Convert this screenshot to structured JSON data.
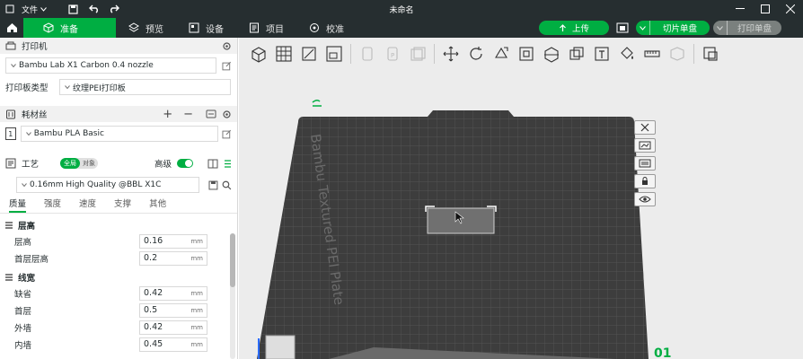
{
  "titlebar": {
    "file_menu": "文件",
    "window_title": "未命名"
  },
  "nav": {
    "tabs": [
      {
        "label": "准备"
      },
      {
        "label": "预览"
      },
      {
        "label": "设备"
      },
      {
        "label": "项目"
      },
      {
        "label": "校准"
      }
    ],
    "upload_label": "上传",
    "slice_label": "切片单盘",
    "print_label": "打印单盘"
  },
  "printer": {
    "section_title": "打印机",
    "printer_name": "Bambu Lab X1 Carbon 0.4 nozzle",
    "plate_type_label": "打印板类型",
    "plate_type_value": "纹理PEI打印板"
  },
  "filament": {
    "section_title": "耗材丝",
    "slot_number": "1",
    "filament_name": "Bambu PLA Basic"
  },
  "process": {
    "section_title": "工艺",
    "toggle_global": "全局",
    "toggle_object": "对象",
    "advanced_label": "高级",
    "preset_name": "0.16mm High Quality @BBL X1C",
    "sub_tabs": [
      "质量",
      "强度",
      "速度",
      "支撑",
      "其他"
    ],
    "groups": [
      {
        "title": "层高",
        "params": [
          {
            "label": "层高",
            "value": "0.16",
            "unit": "mm"
          },
          {
            "label": "首层层高",
            "value": "0.2",
            "unit": "mm"
          }
        ]
      },
      {
        "title": "线宽",
        "params": [
          {
            "label": "缺省",
            "value": "0.42",
            "unit": "mm"
          },
          {
            "label": "首层",
            "value": "0.5",
            "unit": "mm"
          },
          {
            "label": "外墙",
            "value": "0.42",
            "unit": "mm"
          },
          {
            "label": "内墙",
            "value": "0.45",
            "unit": "mm"
          }
        ]
      }
    ]
  },
  "viewport": {
    "plate_label": "Bambu Textured PEI Plate",
    "plate_index": "01"
  },
  "colors": {
    "accent": "#00ae42",
    "titlebar": "#262e30",
    "plate": "#3d3d3d"
  }
}
